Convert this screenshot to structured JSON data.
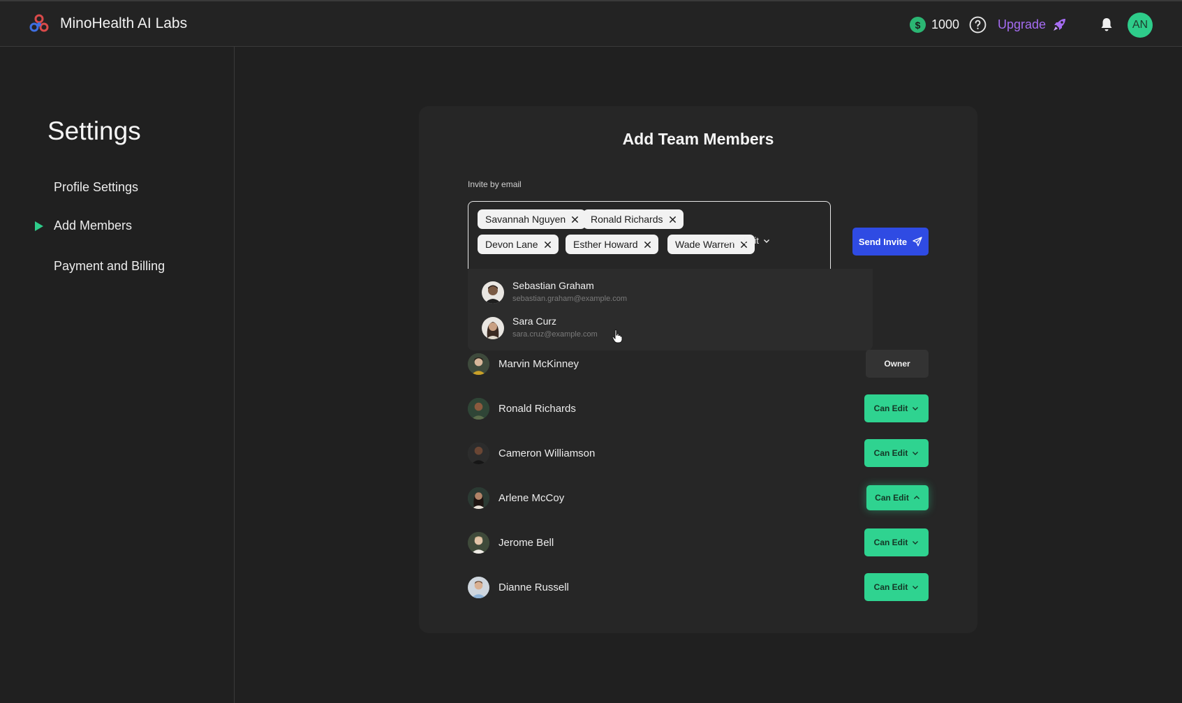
{
  "header": {
    "app_title": "MinoHealth AI Labs",
    "credits": "1000",
    "upgrade_label": "Upgrade",
    "avatar_initials": "AN",
    "accent_color": "#2ecc8a",
    "upgrade_color": "#a56cf2"
  },
  "sidebar": {
    "title": "Settings",
    "items": [
      {
        "label": "Profile Settings",
        "active": false
      },
      {
        "label": "Add Members",
        "active": true
      },
      {
        "label": "Payment and Billing",
        "active": false
      }
    ]
  },
  "card": {
    "title": "Add Team Members",
    "invite_label": "Invite by email",
    "chips": [
      "Savannah Nguyen",
      "Ronald Richards",
      "Devon Lane",
      "Esther Howard",
      "Wade Warren"
    ],
    "role_select": "Can Edit",
    "send_label": "Send Invite",
    "send_color": "#2f4be3",
    "suggestions": [
      {
        "name": "Sebastian Graham",
        "email": "sebastian.graham@example.com"
      },
      {
        "name": "Sara Curz",
        "email": "sara.cruz@example.com"
      }
    ],
    "members": [
      {
        "name": "Marvin McKinney",
        "role": "Owner"
      },
      {
        "name": "Ronald Richards",
        "role": "Can Edit"
      },
      {
        "name": "Cameron Williamson",
        "role": "Can Edit"
      },
      {
        "name": "Arlene McCoy",
        "role": "Can Edit"
      },
      {
        "name": "Jerome Bell",
        "role": "Can Edit"
      },
      {
        "name": "Dianne Russell",
        "role": "Can Edit"
      }
    ]
  }
}
